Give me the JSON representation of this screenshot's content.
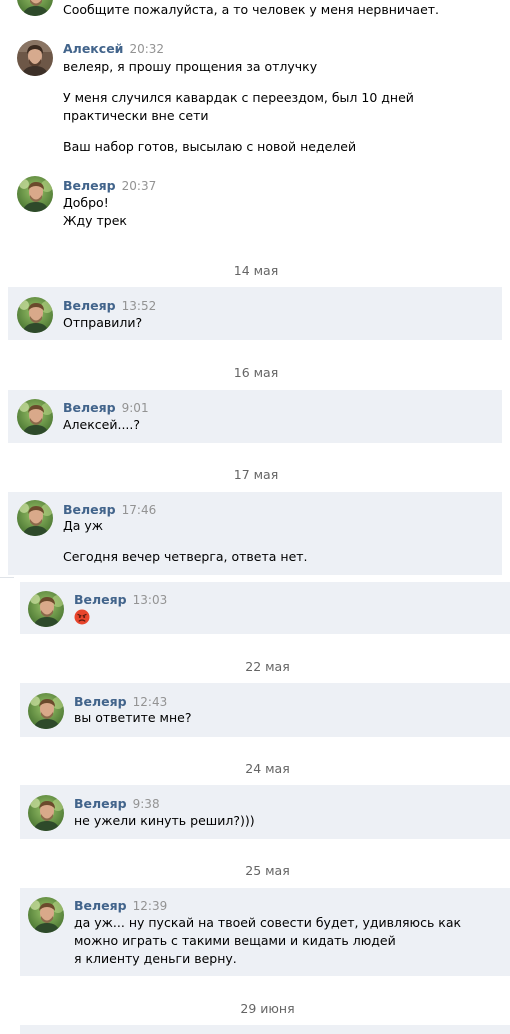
{
  "colors": {
    "unread_bg": "#edf0f5",
    "author": "#42648b",
    "time": "#939393",
    "date": "#656565"
  },
  "messages": [
    {
      "lines": [
        "Сообщите пожалуйста, а то человек у меня нервничает."
      ]
    },
    {
      "author": "Алексей",
      "time": "20:32",
      "lines": [
        "велеяр, я прошу прощения за отлучку",
        "У меня случился кавардак с переездом, был 10 дней",
        "практически вне сети",
        "Ваш набор готов, высылаю с новой неделей"
      ]
    },
    {
      "author": "Велеяр",
      "time": "20:37",
      "lines": [
        "Добро!",
        "Жду трек"
      ]
    },
    {
      "date": "14 мая"
    },
    {
      "author": "Велеяр",
      "time": "13:52",
      "lines": [
        "Отправили?"
      ]
    },
    {
      "date": "16 мая"
    },
    {
      "author": "Велеяр",
      "time": "9:01",
      "lines": [
        "Алексей....?"
      ]
    },
    {
      "date": "17 мая"
    },
    {
      "author": "Велеяр",
      "time": "17:46",
      "lines": [
        "Да уж",
        "Сегодня вечер четверга, ответа нет."
      ]
    },
    {
      "author": "Велеяр",
      "time": "13:03",
      "emoji": "angry-face-emoji"
    },
    {
      "date": "22 мая"
    },
    {
      "author": "Велеяр",
      "time": "12:43",
      "lines": [
        "вы ответите мне?"
      ]
    },
    {
      "date": "24 мая"
    },
    {
      "author": "Велеяр",
      "time": "9:38",
      "lines": [
        "не ужели кинуть решил?)))"
      ]
    },
    {
      "date": "25 мая"
    },
    {
      "author": "Велеяр",
      "time": "12:39",
      "lines": [
        "да уж... ну пускай на твоей совести будет, удивляюсь как",
        "можно играть с такими вещами и кидать людей",
        "я клиенту деньги верну."
      ]
    },
    {
      "date": "29 июня"
    }
  ]
}
